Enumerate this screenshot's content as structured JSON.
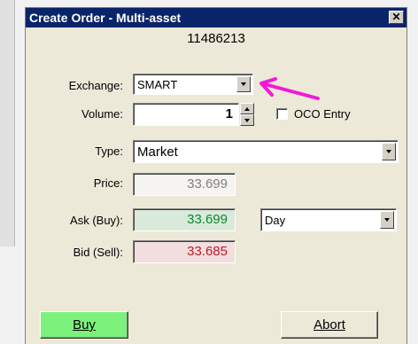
{
  "window": {
    "title": "Create Order - Multi-asset",
    "close_glyph": "✕",
    "order_id": "11486213"
  },
  "form": {
    "exchange_label": "Exchange:",
    "exchange_value": "SMART",
    "volume_label": "Volume:",
    "volume_value": "1",
    "oco_label": "OCO Entry",
    "oco_checked": false,
    "type_label": "Type:",
    "type_value": "Market",
    "price_label": "Price:",
    "price_value": "33.699",
    "ask_label": "Ask (Buy):",
    "ask_value": "33.699",
    "tif_value": "Day",
    "bid_label": "Bid (Sell):",
    "bid_value": "33.685"
  },
  "buttons": {
    "buy_label": "Buy",
    "abort_label": "Abort"
  },
  "colors": {
    "ask_bg": "#d9eadb",
    "ask_text": "#0a8a2a",
    "bid_bg": "#f2dede",
    "bid_text": "#c0182a",
    "buy_bg": "#7cf27c",
    "annotation_arrow": "#f21ad6"
  },
  "icons": {
    "close": "close-icon",
    "dropdown": "chevron-down-icon",
    "spin_up": "spin-up-icon",
    "spin_down": "spin-down-icon",
    "annotation": "arrow-annotation-icon"
  }
}
